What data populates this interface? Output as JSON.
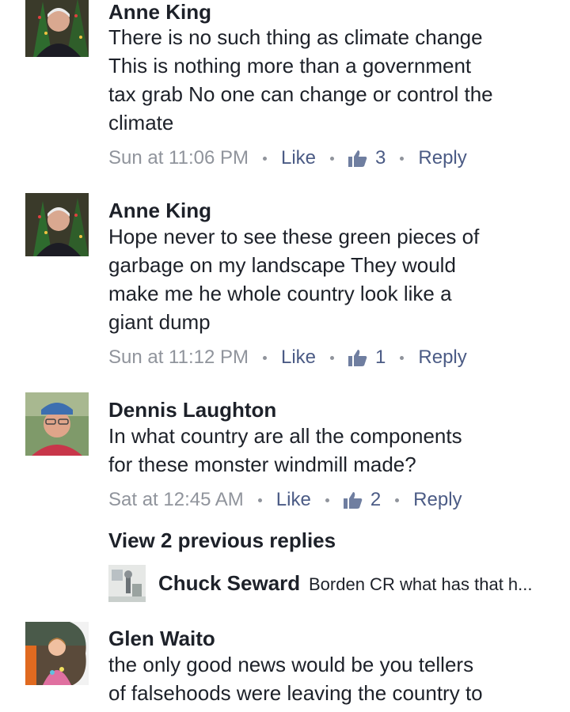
{
  "comments": [
    {
      "author": "Anne King",
      "lines": [
        "There is no such thing as climate change",
        "This is nothing more than a government",
        "tax grab No one can change or control the",
        "climate"
      ],
      "timestamp": "Sun at 11:06 PM",
      "like_label": "Like",
      "like_count": "3",
      "reply_label": "Reply",
      "like_icon": "thumbs-up-icon"
    },
    {
      "author": "Anne King",
      "lines": [
        "Hope never to see these green pieces of",
        "garbage on my landscape They would",
        "make me he whole country look like a",
        "giant dump"
      ],
      "timestamp": "Sun at 11:12 PM",
      "like_label": "Like",
      "like_count": "1",
      "reply_label": "Reply",
      "like_icon": "thumbs-up-icon"
    },
    {
      "author": "Dennis Laughton",
      "lines": [
        "In what country are all the components",
        "for these monster windmill made?"
      ],
      "timestamp": "Sat at 12:45 AM",
      "like_label": "Like",
      "like_count": "2",
      "reply_label": "Reply",
      "like_icon": "thumbs-up-icon"
    },
    {
      "author": "Glen Waito",
      "lines": [
        "the only good news would be you tellers",
        "of falsehoods were leaving the country to"
      ]
    }
  ],
  "replies_section": {
    "view_previous_label": "View 2 previous replies",
    "preview_author": "Chuck Seward",
    "preview_text": "Borden CR what has that h..."
  },
  "colors": {
    "text": "#1d2129",
    "meta": "#90949c",
    "action": "#4b5b85"
  }
}
